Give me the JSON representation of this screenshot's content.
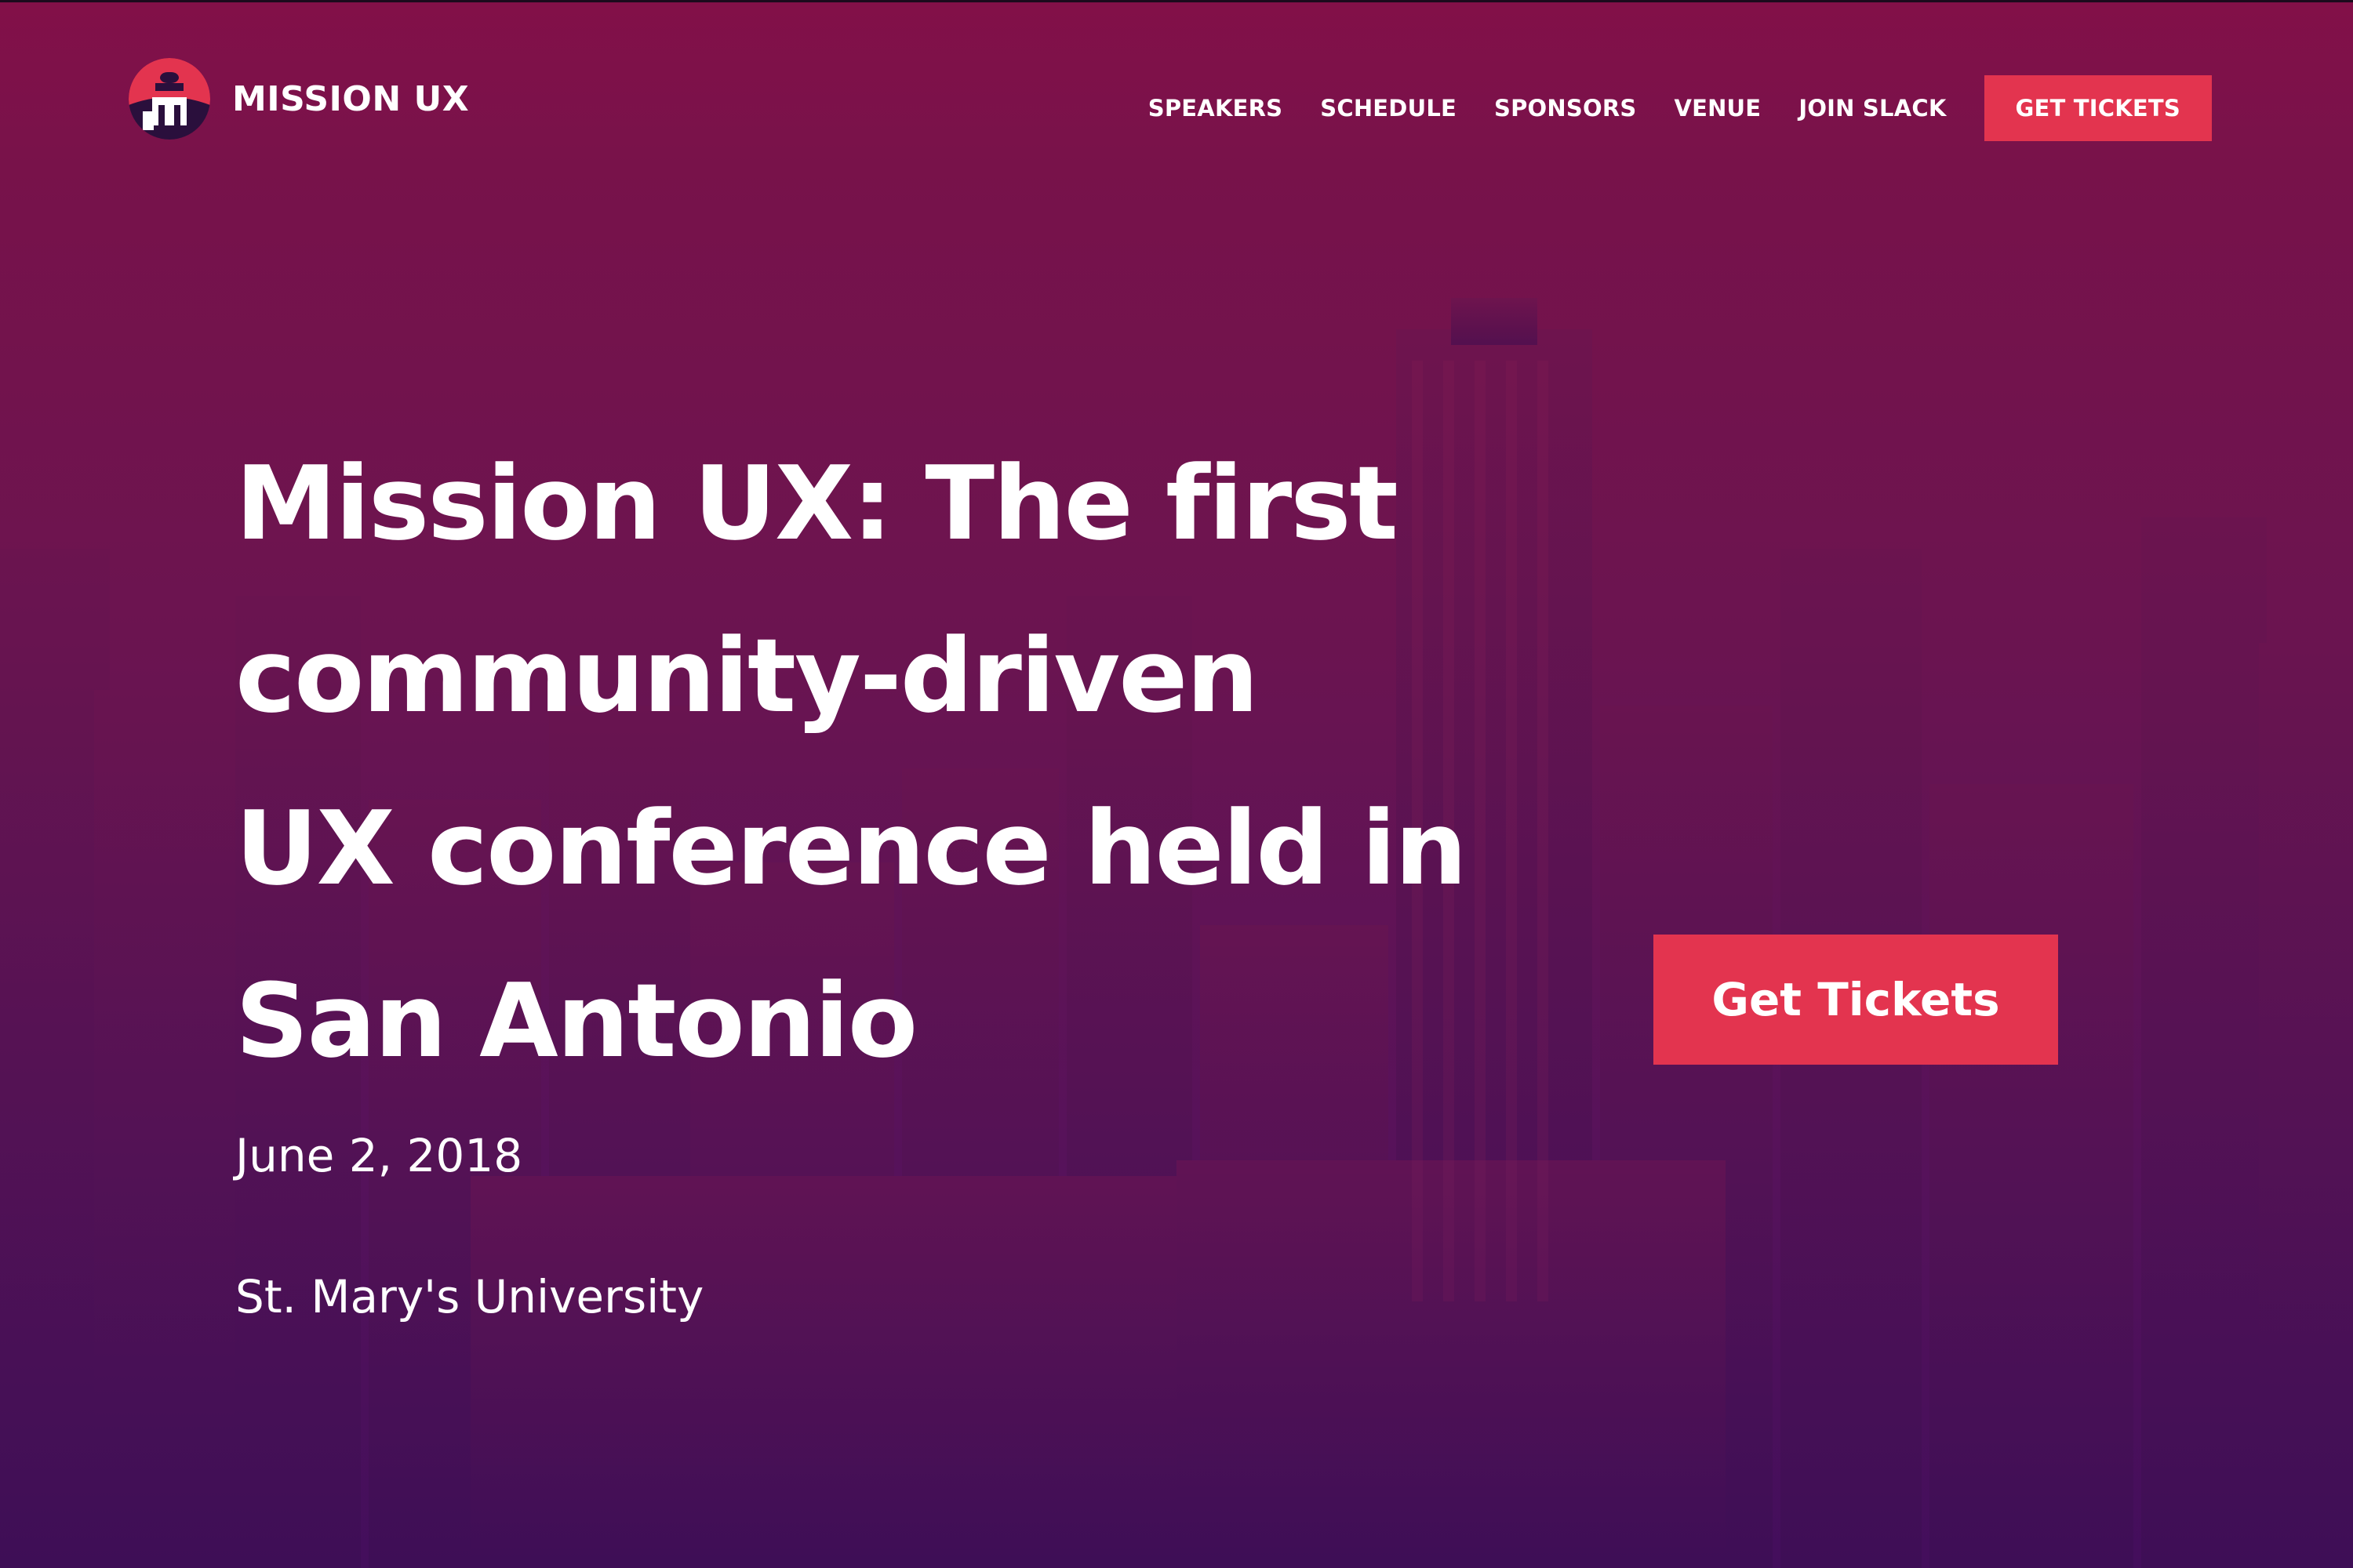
{
  "brand": {
    "name": "MISSION UX",
    "logo_icon": "mission-bell-tower-icon",
    "colors": {
      "accent": "#e3344f",
      "overlay_top": "#84104a",
      "overlay_bottom": "#420e5c",
      "logo_dark": "#2a0f3c"
    }
  },
  "nav": {
    "items": [
      {
        "label": "SPEAKERS"
      },
      {
        "label": "SCHEDULE"
      },
      {
        "label": "SPONSORS"
      },
      {
        "label": "VENUE"
      },
      {
        "label": "JOIN SLACK"
      }
    ],
    "cta_label": "GET TICKETS"
  },
  "hero": {
    "headline_lines": [
      "Mission UX: The first",
      "community-driven",
      "UX conference held in",
      "San Antonio"
    ],
    "cta_label": "Get Tickets",
    "date": "June 2, 2018",
    "venue": "St. Mary's University",
    "background": "san-antonio-skyline-photo"
  }
}
